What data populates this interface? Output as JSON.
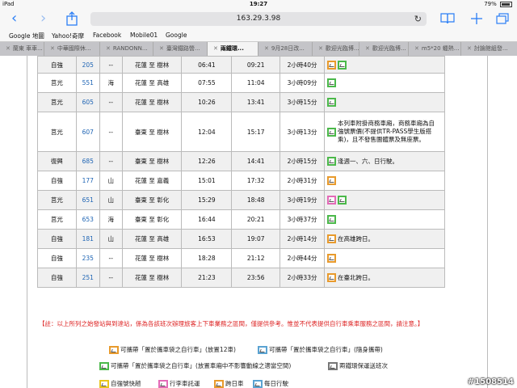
{
  "status": {
    "device": "iPad",
    "time": "19:27",
    "battery": "79%"
  },
  "nav": {
    "url": "163.29.3.98",
    "back_icon": "chevron-left",
    "forward_icon": "chevron-right",
    "share_icon": "share",
    "bookmarks_icon": "book",
    "tabs_icon": "tabs"
  },
  "bookmarks": [
    "Google 地圖",
    "Yahoo!奇摩",
    "Facebook",
    "Mobile01",
    "Google"
  ],
  "tabs": [
    "蘭東 車車...",
    "中華國際休...",
    "RANDONN...",
    "臺灣鐵路營...",
    "兩鐵環...",
    "9月28日改...",
    "歡迎光臨博...",
    "歡迎光臨博...",
    "m5*20 蠟熱...",
    "討論館組發..."
  ],
  "table": {
    "rows": [
      {
        "type": "自強",
        "no": "205",
        "line": "--",
        "route": "花蓮 至 樹林",
        "dep": "06:41",
        "arr": "09:21",
        "dur": "2小時40分",
        "icons": [
          "orange",
          "green"
        ],
        "note": ""
      },
      {
        "type": "莒光",
        "no": "551",
        "line": "海",
        "route": "花蓮 至 高雄",
        "dep": "07:55",
        "arr": "11:04",
        "dur": "3小時09分",
        "icons": [
          "green"
        ],
        "note": ""
      },
      {
        "type": "莒光",
        "no": "605",
        "line": "--",
        "route": "花蓮 至 樹林",
        "dep": "10:26",
        "arr": "13:41",
        "dur": "3小時15分",
        "icons": [
          "green"
        ],
        "note": ""
      },
      {
        "type": "莒光",
        "no": "607",
        "line": "--",
        "route": "臺東 至 樹林",
        "dep": "12:04",
        "arr": "15:17",
        "dur": "3小時13分",
        "icons": [
          "green"
        ],
        "note": "本列車附掛商務車廂，商務車廂為自強號票價(不提供TR-PASS學生版搭乘)，且不發售團體票及無座票。"
      },
      {
        "type": "復興",
        "no": "685",
        "line": "--",
        "route": "臺東 至 樹林",
        "dep": "12:26",
        "arr": "14:41",
        "dur": "2小時15分",
        "icons": [
          "green"
        ],
        "note": "逢週一、六、日行駛。"
      },
      {
        "type": "自強",
        "no": "177",
        "line": "山",
        "route": "花蓮 至 嘉義",
        "dep": "15:01",
        "arr": "17:32",
        "dur": "2小時31分",
        "icons": [
          "orange"
        ],
        "note": ""
      },
      {
        "type": "莒光",
        "no": "651",
        "line": "山",
        "route": "臺東 至 彰化",
        "dep": "15:29",
        "arr": "18:48",
        "dur": "3小時19分",
        "icons": [
          "pink",
          "green"
        ],
        "note": ""
      },
      {
        "type": "莒光",
        "no": "653",
        "line": "海",
        "route": "臺東 至 彰化",
        "dep": "16:44",
        "arr": "20:21",
        "dur": "3小時37分",
        "icons": [
          "green"
        ],
        "note": ""
      },
      {
        "type": "自強",
        "no": "181",
        "line": "山",
        "route": "花蓮 至 高雄",
        "dep": "16:53",
        "arr": "19:07",
        "dur": "2小時14分",
        "icons": [
          "orange"
        ],
        "note": "在高雄跨日。"
      },
      {
        "type": "自強",
        "no": "235",
        "line": "--",
        "route": "花蓮 至 樹林",
        "dep": "18:28",
        "arr": "21:12",
        "dur": "2小時44分",
        "icons": [
          "orange"
        ],
        "note": ""
      },
      {
        "type": "自強",
        "no": "251",
        "line": "--",
        "route": "花蓮 至 樹林",
        "dep": "21:23",
        "arr": "23:56",
        "dur": "2小時33分",
        "icons": [
          "orange"
        ],
        "note": "在臺北跨日。"
      }
    ]
  },
  "disclaimer": "【註：以上所列之始發站與到達站，係為各該班次辦理旅客上下車業務之區間，僅提供參考。惟並不代表提供自行車乘車服務之區間，請注意。】",
  "legend": [
    {
      "color": "orange",
      "text": "可攜帶「置於攜車袋之自行車」(放置12車)"
    },
    {
      "color": "blue",
      "text": "可攜帶「置於攜車袋之自行車」(隨身攜帶)"
    },
    {
      "color": "green",
      "text": "可攜帶「置於攜車袋之自行車」(放置車廂中不影響動線之適當空間)"
    },
    {
      "color": "gray",
      "text": "兩鐵環保運送班次"
    },
    {
      "color": "yellow",
      "text": "自強號快趟"
    },
    {
      "color": "pink",
      "text": "行李車託運"
    },
    {
      "color": "orange",
      "text": "跨日車"
    },
    {
      "color": "blue",
      "text": "每日行駛"
    }
  ],
  "watermark": "#1508514"
}
